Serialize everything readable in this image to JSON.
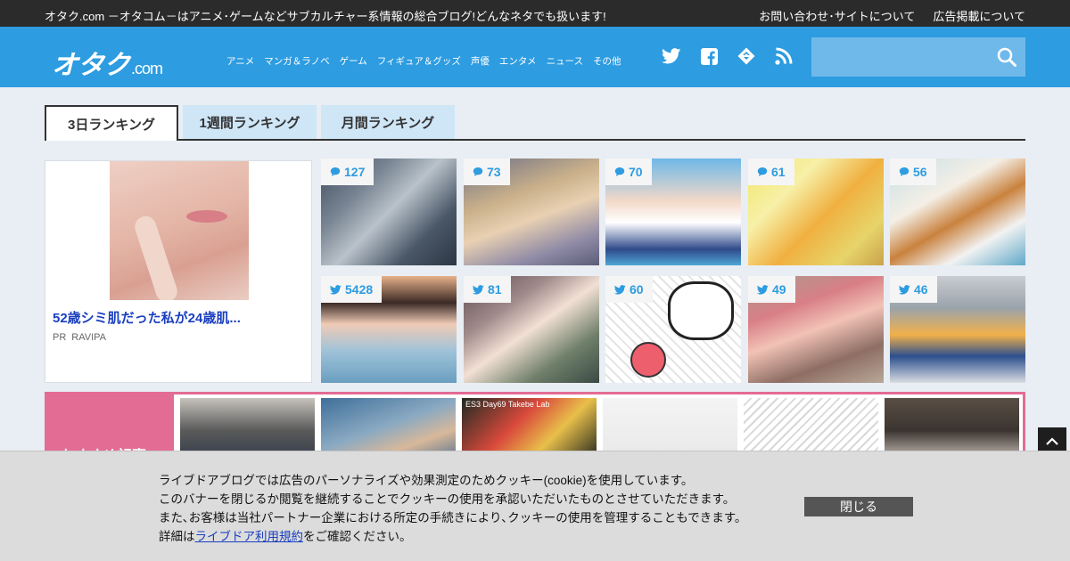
{
  "topbar": {
    "tagline": "オタク.com －オタコム－はアニメ･ゲームなどサブカルチャー系情報の総合ブログ!どんなネタでも扱います!",
    "links": [
      "お問い合わせ･サイトについて",
      "広告掲載について"
    ]
  },
  "header": {
    "logo_main": "オタク",
    "logo_suffix": ".com",
    "nav": [
      "アニメ",
      "マンガ＆ラノベ",
      "ゲーム",
      "フィギュア＆グッズ",
      "声優",
      "エンタメ",
      "ニュース",
      "その他"
    ],
    "social_icons": [
      "twitter-icon",
      "facebook-icon",
      "feedly-icon",
      "rss-icon"
    ],
    "search_placeholder": ""
  },
  "tabs": [
    "3日ランキング",
    "1週間ランキング",
    "月間ランキング"
  ],
  "ad": {
    "title": "52歳シミ肌だった私が24歳肌...",
    "pr": "PR",
    "sponsor": "RAVIPA"
  },
  "ranking": {
    "comment_counts": [
      "127",
      "73",
      "70",
      "61",
      "56"
    ],
    "tweet_counts": [
      "5428",
      "81",
      "60",
      "49",
      "46"
    ]
  },
  "strip": {
    "label": "おすすめ記事",
    "captions": [
      "",
      "",
      "ES3 Day69 Takebe Lab",
      "",
      "",
      ""
    ]
  },
  "cookie": {
    "line1": "ライブドアブログでは広告のパーソナライズや効果測定のためクッキー(cookie)を使用しています。",
    "line2": "このバナーを閉じるか閲覧を継続することでクッキーの使用を承認いただいたものとさせていただきます。",
    "line3": "また､お客様は当社パートナー企業における所定の手続きにより､クッキーの使用を管理することもできます。",
    "line4_pre": "詳細は",
    "line4_link": "ライブドア利用規約",
    "line4_post": "をご確認ください。",
    "close_label": "閉じる"
  },
  "colors": {
    "header": "#2d9ce0",
    "topbar": "#2b2b2b",
    "badge_text": "#2d9ce0",
    "strip": "#e36c95"
  }
}
